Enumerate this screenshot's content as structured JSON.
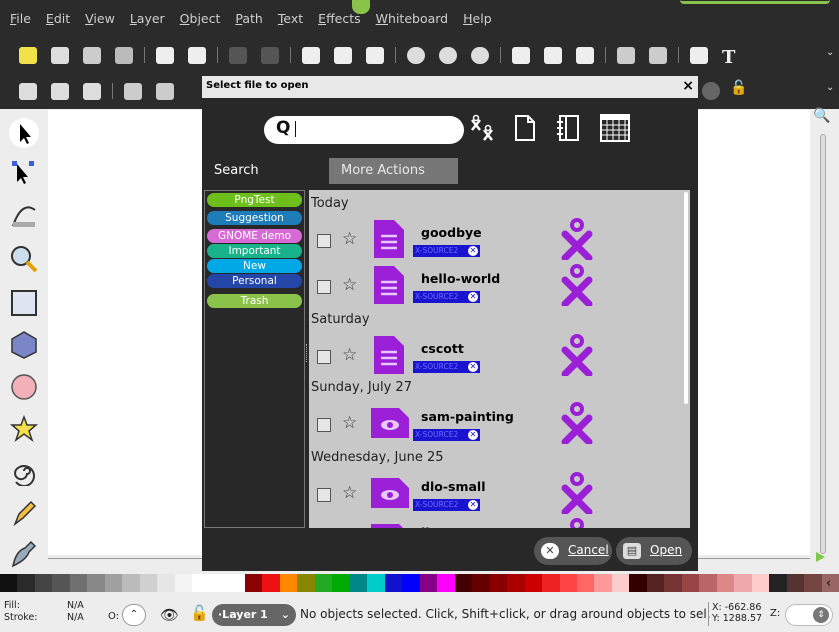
{
  "menu": [
    "File",
    "Edit",
    "View",
    "Layer",
    "Object",
    "Path",
    "Text",
    "Effects",
    "Whiteboard",
    "Help"
  ],
  "dialog": {
    "title": "Select file to open",
    "close": "×",
    "search_placeholder": "",
    "tabs": {
      "search": "Search",
      "more": "More Actions"
    },
    "tags": [
      {
        "label": "PngTest",
        "color": "#6dbf1b"
      },
      {
        "label": "Suggestion",
        "color": "#1e7db8"
      },
      {
        "label": "GNOME demo",
        "color": "#d66bd6"
      },
      {
        "label": "Important",
        "color": "#18b38a"
      },
      {
        "label": "New",
        "color": "#00a8e6"
      },
      {
        "label": "Personal",
        "color": "#2346a8"
      },
      {
        "label": "Trash",
        "color": "#8bc34a"
      }
    ],
    "groups": [
      "Today",
      "Saturday",
      "Sunday, July 27",
      "Wednesday, June 25"
    ],
    "entries": [
      {
        "title": "goodbye",
        "source": "X-SOURCE2",
        "kind": "text"
      },
      {
        "title": "hello-world",
        "source": "X-SOURCE2",
        "kind": "text"
      },
      {
        "title": "cscott",
        "source": "X-SOURCE2",
        "kind": "text"
      },
      {
        "title": "sam-painting",
        "source": "X-SOURCE2",
        "kind": "image"
      },
      {
        "title": "dlo-small",
        "source": "X-SOURCE2",
        "kind": "image"
      },
      {
        "title": "ilo",
        "source": "",
        "kind": "image"
      }
    ],
    "cancel": "Cancel",
    "open": "Open"
  },
  "status": {
    "fill_label": "Fill:",
    "stroke_label": "Stroke:",
    "fill_value": "N/A",
    "stroke_value": "N/A",
    "opacity_label": "O:",
    "layer": "·Layer 1",
    "message": "No objects selected. Click, Shift+click, or drag around objects to sel.",
    "x": "X: -662.86",
    "y": "Y: 1288.57",
    "zoom_label": "Z:"
  },
  "palette": [
    "#111111",
    "#2a2a2a",
    "#444444",
    "#555555",
    "#6f6f6f",
    "#888888",
    "#a0a0a0",
    "#bbbbbb",
    "#d0d0d0",
    "#e6e6e6",
    "#f4f4f4",
    "#ffffff",
    "#ffffff",
    "#ffffff",
    "#8b0000",
    "#ee1111",
    "#ff8800",
    "#888800",
    "#22aa22",
    "#00aa00",
    "#008888",
    "#00cccc",
    "#1111cc",
    "#0000ff",
    "#880088",
    "#ff00ff",
    "#440000",
    "#660000",
    "#880000",
    "#aa0000",
    "#cc0000",
    "#ee2222",
    "#ff4444",
    "#ff6666",
    "#ff9999",
    "#ffcccc",
    "#330000",
    "#552222",
    "#773333",
    "#994444",
    "#bb6666",
    "#dd8888",
    "#eeaaaa",
    "#ffcccc",
    "#222222",
    "#553333",
    "#774444",
    "#996666"
  ]
}
